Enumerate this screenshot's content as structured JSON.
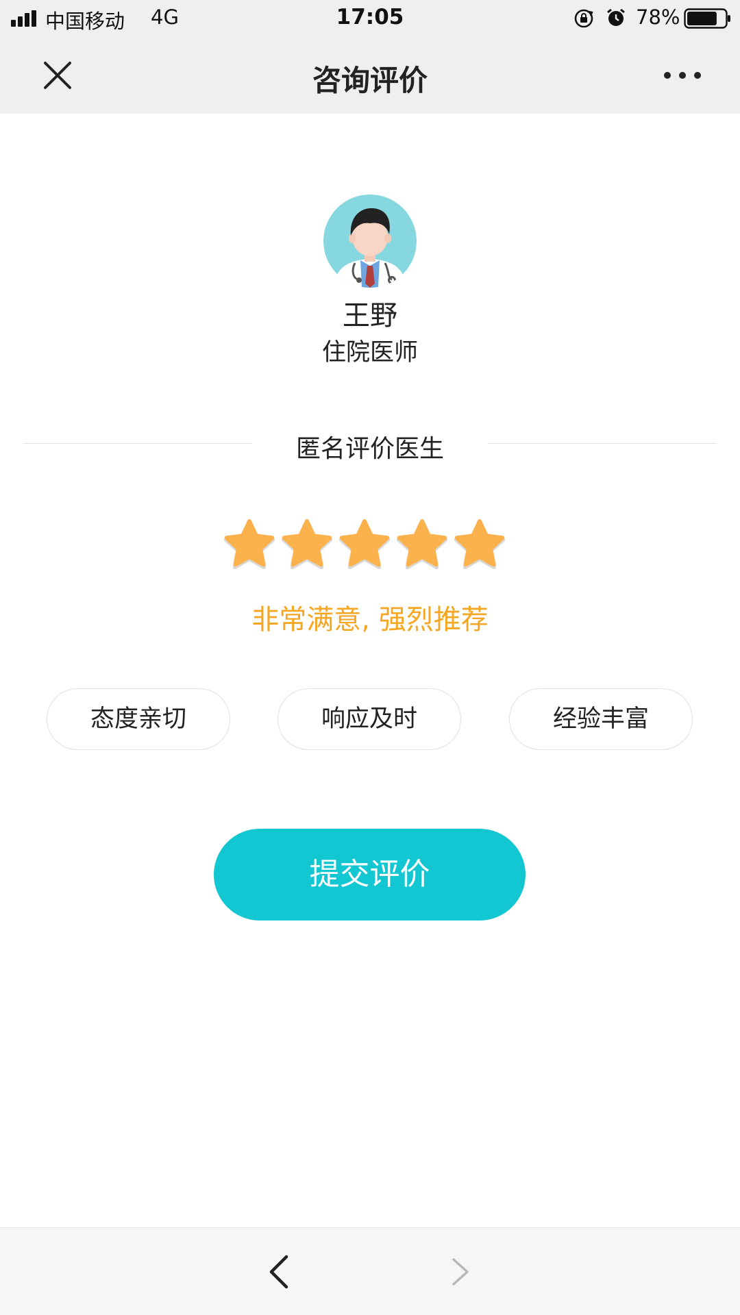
{
  "status_bar": {
    "carrier": "中国移动",
    "network": "4G",
    "time": "17:05",
    "battery_percent": "78%",
    "battery_level": 0.78,
    "signal_bars": 4
  },
  "nav": {
    "title": "咨询评价",
    "close_icon": "close-icon",
    "more_icon": "more-icon"
  },
  "doctor": {
    "name": "王野",
    "title": "住院医师",
    "avatar_icon": "doctor-avatar"
  },
  "rating": {
    "section_label": "匿名评价医生",
    "stars_selected": 5,
    "stars_total": 5,
    "star_color": "#fbb24c",
    "text": "非常满意, 强烈推荐",
    "text_color": "#f5a623"
  },
  "tags": [
    {
      "label": "态度亲切"
    },
    {
      "label": "响应及时"
    },
    {
      "label": "经验丰富"
    }
  ],
  "submit": {
    "label": "提交评价",
    "color": "#12c7d2"
  },
  "toolbar": {
    "back_icon": "chevron-left-icon",
    "forward_icon": "chevron-right-icon"
  }
}
